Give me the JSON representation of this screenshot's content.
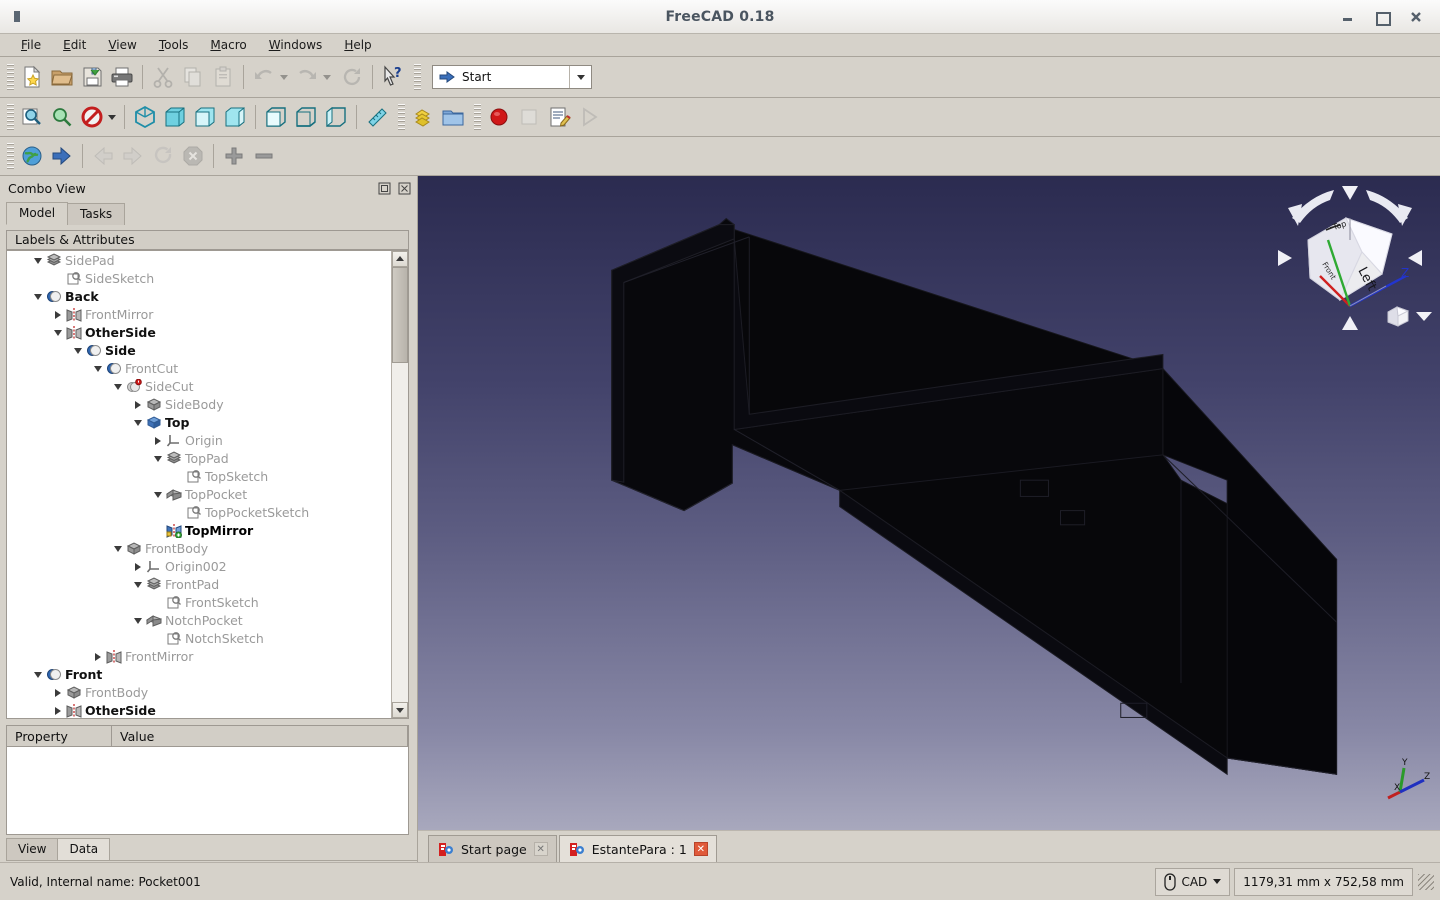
{
  "window": {
    "title": "FreeCAD 0.18",
    "app_icon": "app-icon",
    "minimize": "–",
    "maximize": "□",
    "close": "✖"
  },
  "menubar": {
    "items": [
      {
        "label": "File",
        "accel": "F"
      },
      {
        "label": "Edit",
        "accel": "E"
      },
      {
        "label": "View",
        "accel": "V"
      },
      {
        "label": "Tools",
        "accel": "T"
      },
      {
        "label": "Macro",
        "accel": "M"
      },
      {
        "label": "Windows",
        "accel": "W"
      },
      {
        "label": "Help",
        "accel": "H"
      }
    ]
  },
  "toolbars": {
    "file": [
      {
        "name": "new-document-icon",
        "enabled": true
      },
      {
        "name": "open-document-icon",
        "enabled": true
      },
      {
        "name": "save-document-icon",
        "enabled": true
      },
      {
        "name": "print-icon",
        "enabled": true
      },
      {
        "name": "cut-icon",
        "enabled": false
      },
      {
        "name": "copy-icon",
        "enabled": false
      },
      {
        "name": "paste-icon",
        "enabled": false
      },
      {
        "name": "undo-icon",
        "enabled": false
      },
      {
        "name": "redo-icon",
        "enabled": false
      },
      {
        "name": "refresh-icon",
        "enabled": false
      },
      {
        "name": "whats-this-icon",
        "enabled": true
      }
    ],
    "workbench_selector": {
      "value": "Start",
      "icon": "start-arrow-icon",
      "dropdown_icon": "chevron-down-icon"
    },
    "view": [
      {
        "name": "fit-all-icon",
        "enabled": true
      },
      {
        "name": "fit-selection-icon",
        "enabled": true
      },
      {
        "name": "draw-style-icon",
        "enabled": true
      },
      {
        "name": "axonometric-view-icon",
        "enabled": true
      },
      {
        "name": "front-view-icon",
        "enabled": true
      },
      {
        "name": "top-view-icon",
        "enabled": true
      },
      {
        "name": "right-view-icon",
        "enabled": true
      },
      {
        "name": "rear-view-icon",
        "enabled": true
      },
      {
        "name": "bottom-view-icon",
        "enabled": true
      },
      {
        "name": "left-view-icon",
        "enabled": true
      },
      {
        "name": "measure-icon",
        "enabled": true
      }
    ],
    "structure": [
      {
        "name": "create-part-icon",
        "enabled": true
      },
      {
        "name": "create-group-icon",
        "enabled": true
      }
    ],
    "macro": [
      {
        "name": "macro-record-icon",
        "enabled": true
      },
      {
        "name": "macro-stop-icon",
        "enabled": false
      },
      {
        "name": "macro-edit-icon",
        "enabled": true
      },
      {
        "name": "macro-execute-icon",
        "enabled": false
      }
    ],
    "web": [
      {
        "name": "browser-home-icon",
        "enabled": true
      },
      {
        "name": "open-website-icon",
        "enabled": true
      },
      {
        "name": "browser-back-icon",
        "enabled": false
      },
      {
        "name": "browser-forward-icon",
        "enabled": false
      },
      {
        "name": "browser-refresh-icon",
        "enabled": false
      },
      {
        "name": "browser-stop-icon",
        "enabled": false
      },
      {
        "name": "zoom-in-icon",
        "enabled": true
      },
      {
        "name": "zoom-out-icon",
        "enabled": true
      }
    ]
  },
  "combo_view": {
    "title": "Combo View",
    "float_icon": "undock-icon",
    "close_icon": "close-icon",
    "tabs": [
      {
        "label": "Model",
        "active": true
      },
      {
        "label": "Tasks",
        "active": false
      }
    ],
    "tree_column_header": "Labels & Attributes",
    "tree": [
      {
        "label": "SidePad",
        "depth": 1,
        "twist": "down",
        "icon": "pad-icon",
        "state": "hidden"
      },
      {
        "label": "SideSketch",
        "depth": 2,
        "twist": "none",
        "icon": "sketch-icon",
        "state": "hidden"
      },
      {
        "label": "Back",
        "depth": 1,
        "twist": "down",
        "icon": "boolean-icon",
        "state": "visible"
      },
      {
        "label": "FrontMirror",
        "depth": 2,
        "twist": "right",
        "icon": "mirror-icon",
        "state": "hidden"
      },
      {
        "label": "OtherSide",
        "depth": 2,
        "twist": "down",
        "icon": "mirror-icon",
        "state": "visible"
      },
      {
        "label": "Side",
        "depth": 3,
        "twist": "down",
        "icon": "boolean-icon",
        "state": "visible"
      },
      {
        "label": "FrontCut",
        "depth": 4,
        "twist": "down",
        "icon": "boolean-icon",
        "state": "hidden"
      },
      {
        "label": "SideCut",
        "depth": 5,
        "twist": "down",
        "icon": "boolean-error-icon",
        "state": "hidden"
      },
      {
        "label": "SideBody",
        "depth": 6,
        "twist": "right",
        "icon": "body-icon",
        "state": "hidden"
      },
      {
        "label": "Top",
        "depth": 6,
        "twist": "down",
        "icon": "body-blue-icon",
        "state": "visible"
      },
      {
        "label": "Origin",
        "depth": 7,
        "twist": "right",
        "icon": "origin-icon",
        "state": "hidden"
      },
      {
        "label": "TopPad",
        "depth": 7,
        "twist": "down",
        "icon": "pad-icon",
        "state": "hidden"
      },
      {
        "label": "TopSketch",
        "depth": 8,
        "twist": "none",
        "icon": "sketch-icon",
        "state": "hidden"
      },
      {
        "label": "TopPocket",
        "depth": 7,
        "twist": "down",
        "icon": "pocket-icon",
        "state": "hidden"
      },
      {
        "label": "TopPocketSketch",
        "depth": 8,
        "twist": "none",
        "icon": "sketch-icon",
        "state": "hidden"
      },
      {
        "label": "TopMirror",
        "depth": 7,
        "twist": "none",
        "icon": "mirror-tip-icon",
        "state": "tip"
      },
      {
        "label": "FrontBody",
        "depth": 5,
        "twist": "down",
        "icon": "body-icon",
        "state": "hidden"
      },
      {
        "label": "Origin002",
        "depth": 6,
        "twist": "right",
        "icon": "origin-icon",
        "state": "hidden"
      },
      {
        "label": "FrontPad",
        "depth": 6,
        "twist": "down",
        "icon": "pad-icon",
        "state": "hidden"
      },
      {
        "label": "FrontSketch",
        "depth": 7,
        "twist": "none",
        "icon": "sketch-icon",
        "state": "hidden"
      },
      {
        "label": "NotchPocket",
        "depth": 6,
        "twist": "down",
        "icon": "pocket-icon",
        "state": "hidden"
      },
      {
        "label": "NotchSketch",
        "depth": 7,
        "twist": "none",
        "icon": "sketch-icon",
        "state": "hidden"
      },
      {
        "label": "FrontMirror",
        "depth": 4,
        "twist": "right",
        "icon": "mirror-icon",
        "state": "hidden"
      },
      {
        "label": "Front",
        "depth": 1,
        "twist": "down",
        "icon": "boolean-icon",
        "state": "visible"
      },
      {
        "label": "FrontBody",
        "depth": 2,
        "twist": "right",
        "icon": "body-icon",
        "state": "hidden"
      },
      {
        "label": "OtherSide",
        "depth": 2,
        "twist": "right",
        "icon": "mirror-icon",
        "state": "visible"
      }
    ],
    "property_panel": {
      "columns": [
        "Property",
        "Value"
      ],
      "rows": []
    },
    "bottom_tabs": [
      {
        "label": "View",
        "active": false
      },
      {
        "label": "Data",
        "active": true
      }
    ]
  },
  "view3d": {
    "navigation_cube": {
      "face_label": "Left",
      "axis_label_z": "Z",
      "rotate_left_icon": "rotate-ccw-icon",
      "rotate_right_icon": "rotate-cw-icon",
      "arrow_up_icon": "arrow-up-icon",
      "arrow_down_icon": "arrow-down-icon",
      "arrow_left_icon": "arrow-left-icon",
      "arrow_right_icon": "arrow-right-icon",
      "home_cube_icon": "home-cube-icon",
      "menu_caret_icon": "chevron-down-icon"
    },
    "axis_indicator": {
      "x": "X",
      "y": "Y",
      "z": "Z"
    },
    "background": {
      "top": "#2b2b50",
      "bottom": "#a8a8bd"
    },
    "model_color": "#060608"
  },
  "document_tabs": [
    {
      "label": "Start page",
      "active": false,
      "close_icon": "close-icon",
      "doc_icon": "freecad-doc-icon"
    },
    {
      "label": "EstantePara : 1",
      "active": true,
      "close_icon": "close-icon",
      "doc_icon": "freecad-doc-icon"
    }
  ],
  "statusbar": {
    "message": "Valid, Internal name: Pocket001",
    "navigation_style": "CAD",
    "navigation_icon": "mouse-icon",
    "navigation_caret": "chevron-down-icon",
    "dimensions": "1179,31 mm x 752,58 mm",
    "resize_grip": "resize-grip-icon"
  }
}
